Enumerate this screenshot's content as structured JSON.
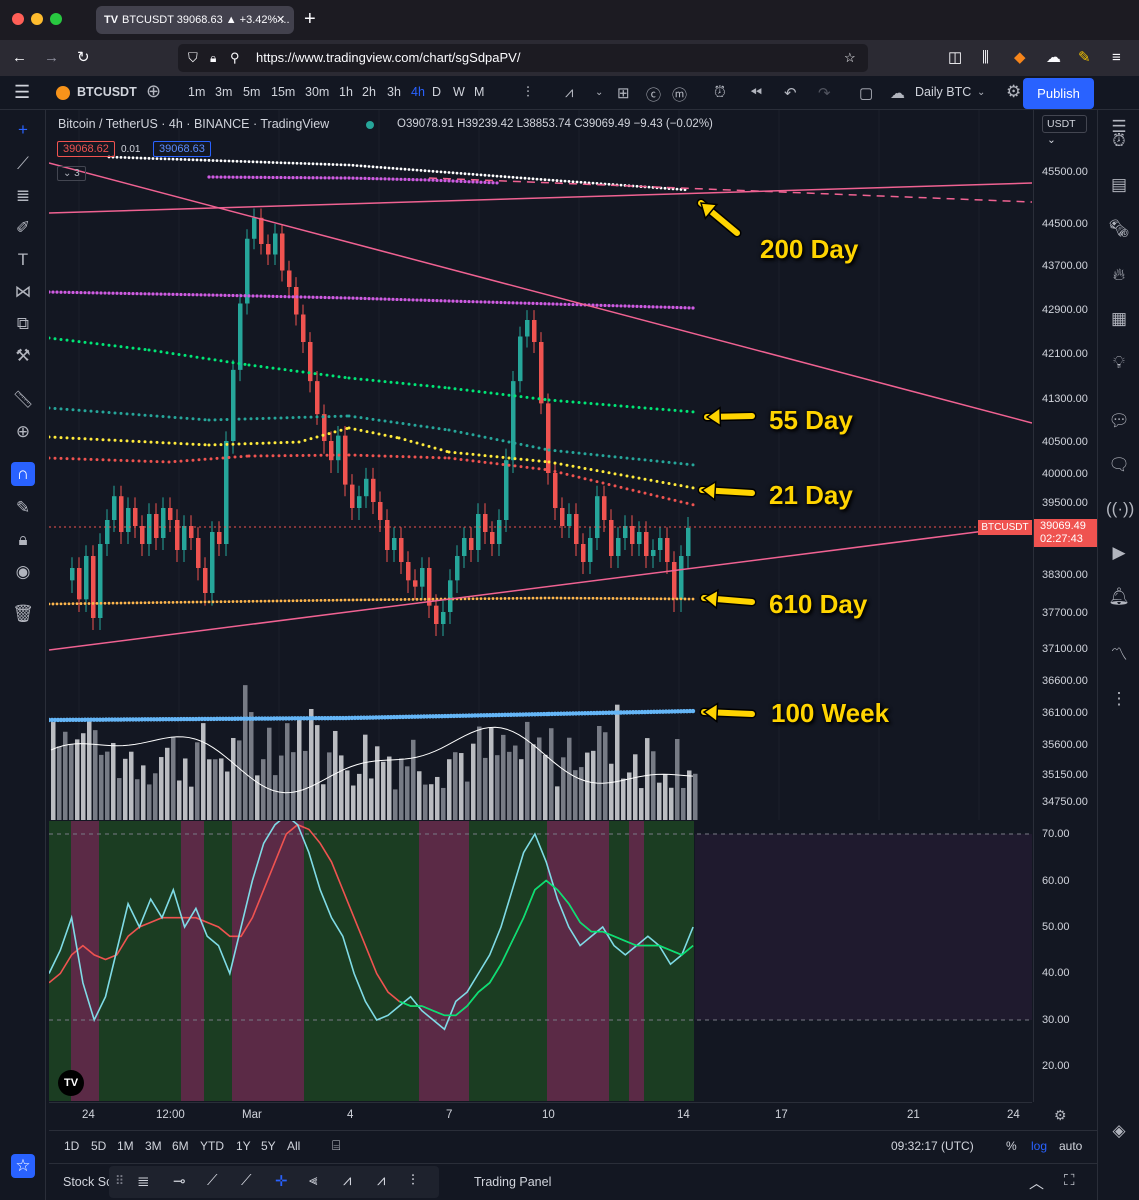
{
  "browser": {
    "tab_title": "BTCUSDT 39068.63 ▲ +3.42% ...",
    "url": "https://www.tradingview.com/chart/sgSdpaPV/"
  },
  "toolbar": {
    "symbol": "BTCUSDT",
    "timeframes": [
      "1m",
      "3m",
      "5m",
      "15m",
      "30m",
      "1h",
      "2h",
      "3h",
      "4h",
      "D",
      "W",
      "M"
    ],
    "active_timeframe": "4h",
    "layout_name": "Daily BTC",
    "publish_label": "Publish"
  },
  "legend": {
    "title": "Bitcoin / TetherUS · 4h · BINANCE · TradingView",
    "ohlc": "O39078.91 H39239.42 L38853.74 C39069.49 −9.43 (−0.02%)",
    "bid": "39068.62",
    "spread": "0.01",
    "ask": "39068.63",
    "indicators_count": "3"
  },
  "price_axis": {
    "currency": "USDT",
    "labels": [
      "45500.00",
      "44500.00",
      "43700.00",
      "42900.00",
      "42100.00",
      "41300.00",
      "40500.00",
      "40000.00",
      "39500.00",
      "38300.00",
      "37700.00",
      "37100.00",
      "36600.00",
      "36100.00",
      "35600.00",
      "35150.00",
      "34750.00"
    ],
    "last_price": "39069.49",
    "countdown": "02:27:43",
    "last_tag": "BTCUSDT"
  },
  "rsi_axis": {
    "labels": [
      "70.00",
      "60.00",
      "50.00",
      "40.00",
      "30.00",
      "20.00"
    ]
  },
  "time_axis": {
    "labels": [
      "24",
      "12:00",
      "Mar",
      "4",
      "7",
      "10",
      "14",
      "17",
      "21",
      "24"
    ]
  },
  "annotations": [
    "200 Day",
    "55 Day",
    "21 Day",
    "610 Day",
    "100 Week"
  ],
  "bottom": {
    "ranges": [
      "1D",
      "5D",
      "1M",
      "3M",
      "6M",
      "YTD",
      "1Y",
      "5Y",
      "All"
    ],
    "clock": "09:32:17 (UTC)",
    "percent": "%",
    "log": "log",
    "auto": "auto",
    "panel_left": "Stock Sc",
    "trading_panel": "Trading Panel"
  },
  "colors": {
    "up": "#26a69a",
    "down": "#ef5350",
    "trendline": "#f06292",
    "ma200": "#d05ce3",
    "ma55": "#00e676",
    "ma21": "#ffeb3b",
    "ma610": "#ffb74d",
    "w100": "#64b5f6",
    "annotation": "#ffd400"
  }
}
